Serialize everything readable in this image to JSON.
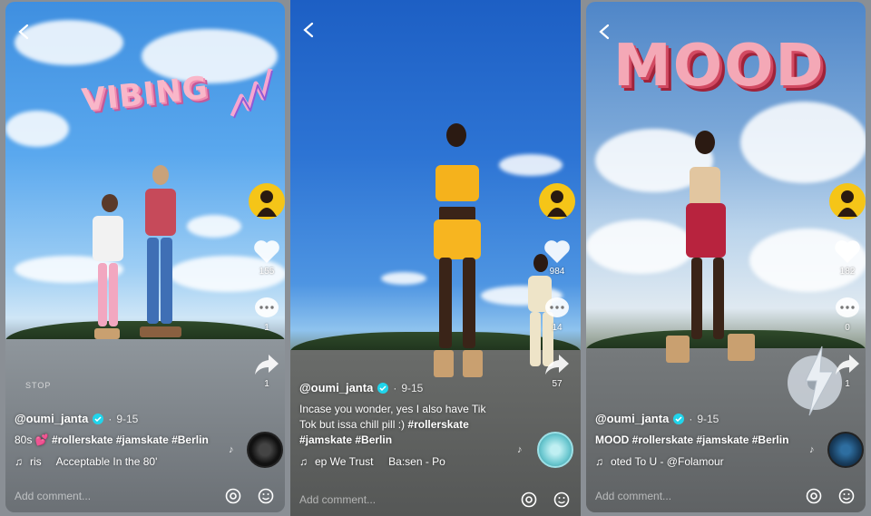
{
  "panels": [
    {
      "handle": "@oumi_janta",
      "date": "9-15",
      "caption_line1_prefix": "80s",
      "caption_line1_tags": "#rollerskate #jamskate #Berlin",
      "music": "ris     Acceptable In the 80'",
      "likes": "155",
      "comments": "1",
      "shares": "1",
      "sticker": "VIBING",
      "sign_text": "STOP",
      "comment_placeholder": "Add comment..."
    },
    {
      "handle": "@oumi_janta",
      "date": "9-15",
      "caption_line1": "Incase you wonder, yes I also have Tik",
      "caption_line2_plain": "Tok but issa chill pill :)",
      "caption_line2_tag": "#rollerskate",
      "caption_line3": "#jamskate #Berlin",
      "music": "ep We Trust     Ba:sen - Po",
      "likes": "984",
      "comments": "14",
      "shares": "57",
      "comment_placeholder": "Add comment..."
    },
    {
      "handle": "@oumi_janta",
      "date": "9-15",
      "caption_line1": "MOOD #rollerskate #jamskate #Berlin",
      "music": "oted To U - @Folamour",
      "likes": "182",
      "comments": "0",
      "shares": "1",
      "sticker": "MOOD",
      "comment_placeholder": "Add comment..."
    }
  ],
  "colors": {
    "verified": "#20d5ec",
    "avatar_ring": "#f5c518",
    "heart_emoji": "#ff5fa8"
  },
  "icons": [
    "back-arrow-icon",
    "avatar",
    "heart-icon",
    "comment-bubble-icon",
    "share-arrow-icon",
    "music-note-icon",
    "spinning-disc",
    "at-mention-icon",
    "emoji-icon",
    "verified-badge-icon"
  ]
}
